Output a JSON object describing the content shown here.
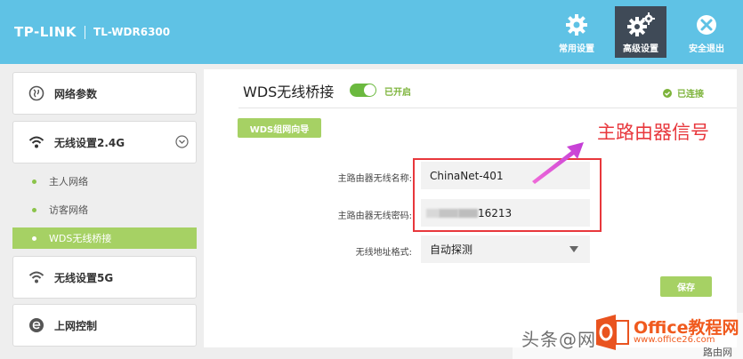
{
  "header": {
    "brand": "TP-LINK",
    "model": "TL-WDR6300",
    "buttons": [
      {
        "label": "常用设置",
        "icon": "gear-icon",
        "active": false
      },
      {
        "label": "高级设置",
        "icon": "gears-icon",
        "active": true
      },
      {
        "label": "安全退出",
        "icon": "exit-icon",
        "active": false
      }
    ]
  },
  "sidebar": {
    "network": "网络参数",
    "wireless24": "无线设置2.4G",
    "sub_items": [
      "主人网络",
      "访客网络",
      "WDS无线桥接"
    ],
    "active_sub": "WDS无线桥接",
    "wireless5": "无线设置5G",
    "online_control": "上网控制"
  },
  "main": {
    "title": "WDS无线桥接",
    "toggle_state": "已开启",
    "status": "已连接",
    "wizard_button": "WDS组网向导",
    "fields": {
      "ssid_label": "主路由器无线名称:",
      "ssid_value": "ChinaNet-401",
      "password_label": "主路由器无线密码:",
      "password_value": "16213",
      "addr_label": "无线地址格式:",
      "addr_value": "自动探测"
    },
    "save_button": "保存"
  },
  "annotation": {
    "text": "主路由器信号"
  },
  "watermark": {
    "prefix": "头条@网",
    "site": "Office教程网",
    "site_url": "www.office26.com",
    "corner": "路由网"
  },
  "colors": {
    "header": "#5fc2e5",
    "accent_green": "#a6d164",
    "annotation_red": "#e8373c",
    "active_button": "#3f4a57"
  }
}
